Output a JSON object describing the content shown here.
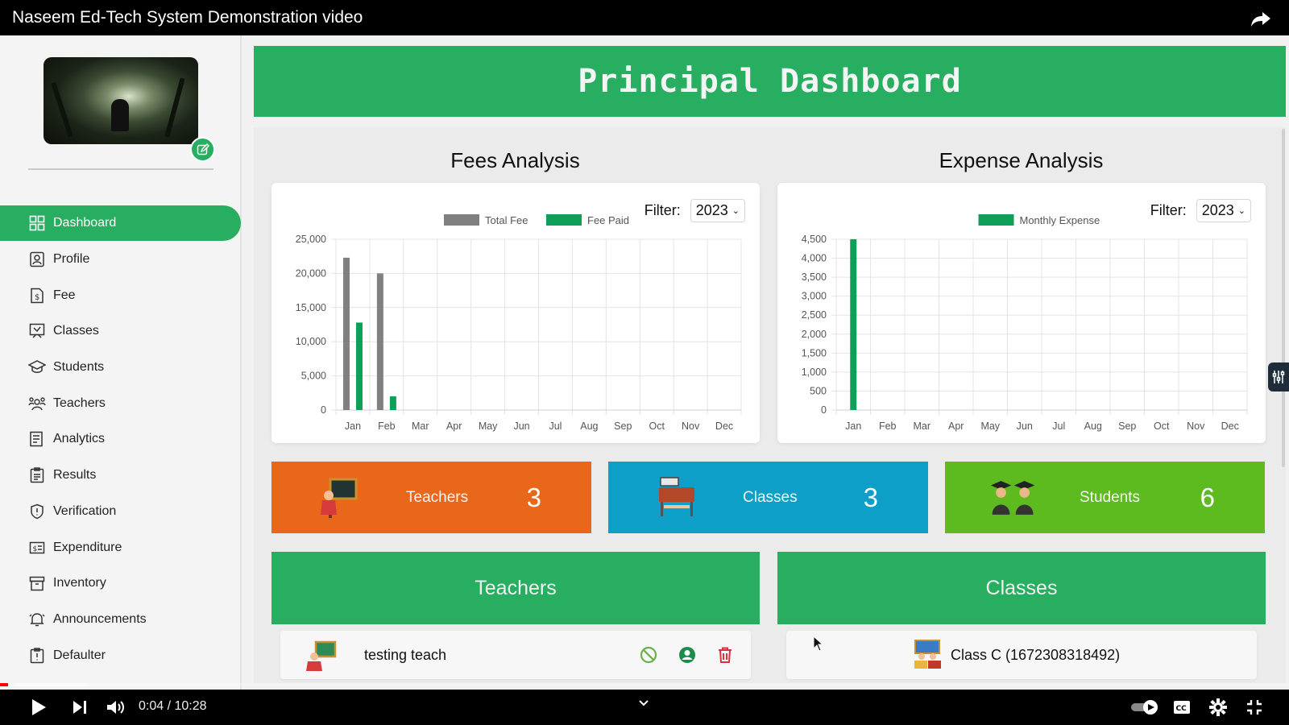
{
  "video": {
    "title": "Naseem Ed-Tech System Demonstration video",
    "time": "0:04 / 10:28",
    "progress_fraction": 0.0064
  },
  "sidebar": {
    "items": [
      {
        "label": "Dashboard",
        "icon": "grid-icon",
        "active": true
      },
      {
        "label": "Profile",
        "icon": "profile-icon"
      },
      {
        "label": "Fee",
        "icon": "fee-icon"
      },
      {
        "label": "Classes",
        "icon": "classes-icon"
      },
      {
        "label": "Students",
        "icon": "students-icon"
      },
      {
        "label": "Teachers",
        "icon": "teachers-icon"
      },
      {
        "label": "Analytics",
        "icon": "analytics-icon"
      },
      {
        "label": "Results",
        "icon": "results-icon"
      },
      {
        "label": "Verification",
        "icon": "shield-icon"
      },
      {
        "label": "Expenditure",
        "icon": "expenditure-icon"
      },
      {
        "label": "Inventory",
        "icon": "inventory-icon"
      },
      {
        "label": "Announcements",
        "icon": "bell-icon"
      },
      {
        "label": "Defaulter",
        "icon": "alert-icon"
      }
    ]
  },
  "header": {
    "title": "Principal Dashboard"
  },
  "fees": {
    "title": "Fees Analysis",
    "filter_label": "Filter:",
    "filter_value": "2023"
  },
  "expense": {
    "title": "Expense Analysis",
    "filter_label": "Filter:",
    "filter_value": "2023"
  },
  "stats": {
    "teachers": {
      "label": "Teachers",
      "value": "3",
      "color": "#e8671a"
    },
    "classes": {
      "label": "Classes",
      "value": "3",
      "color": "#0e9fc8"
    },
    "students": {
      "label": "Students",
      "value": "6",
      "color": "#5dbb1f"
    }
  },
  "teachers_panel": {
    "title": "Teachers",
    "rows": [
      {
        "name": "testing teach"
      }
    ]
  },
  "classes_panel": {
    "title": "Classes",
    "rows": [
      {
        "name": "Class C  (1672308318492)"
      }
    ]
  },
  "colors": {
    "brand_green": "#27ae60",
    "total_fee": "#808080",
    "fee_paid": "#0e9f58",
    "delete_red": "#d9333f"
  },
  "chart_data": [
    {
      "type": "bar",
      "categories": [
        "Jan",
        "Feb",
        "Mar",
        "Apr",
        "May",
        "Jun",
        "Jul",
        "Aug",
        "Sep",
        "Oct",
        "Nov",
        "Dec"
      ],
      "series": [
        {
          "name": "Total Fee",
          "color": "#808080",
          "values": [
            22300,
            20000,
            0,
            0,
            0,
            0,
            0,
            0,
            0,
            0,
            0,
            0
          ]
        },
        {
          "name": "Fee Paid",
          "color": "#0e9f58",
          "values": [
            12800,
            2000,
            0,
            0,
            0,
            0,
            0,
            0,
            0,
            0,
            0,
            0
          ]
        }
      ],
      "yticks": [
        "0",
        "5,000",
        "10,000",
        "15,000",
        "20,000",
        "25,000"
      ],
      "ylim": [
        0,
        25000
      ],
      "grid": true,
      "legend": "top"
    },
    {
      "type": "bar",
      "categories": [
        "Jan",
        "Feb",
        "Mar",
        "Apr",
        "May",
        "Jun",
        "Jul",
        "Aug",
        "Sep",
        "Oct",
        "Nov",
        "Dec"
      ],
      "series": [
        {
          "name": "Monthly Expense",
          "color": "#0e9f58",
          "values": [
            4500,
            0,
            0,
            0,
            0,
            0,
            0,
            0,
            0,
            0,
            0,
            0
          ]
        }
      ],
      "yticks": [
        "0",
        "500",
        "1,000",
        "1,500",
        "2,000",
        "2,500",
        "3,000",
        "3,500",
        "4,000",
        "4,500"
      ],
      "ylim": [
        0,
        4500
      ],
      "grid": true,
      "legend": "top"
    }
  ]
}
